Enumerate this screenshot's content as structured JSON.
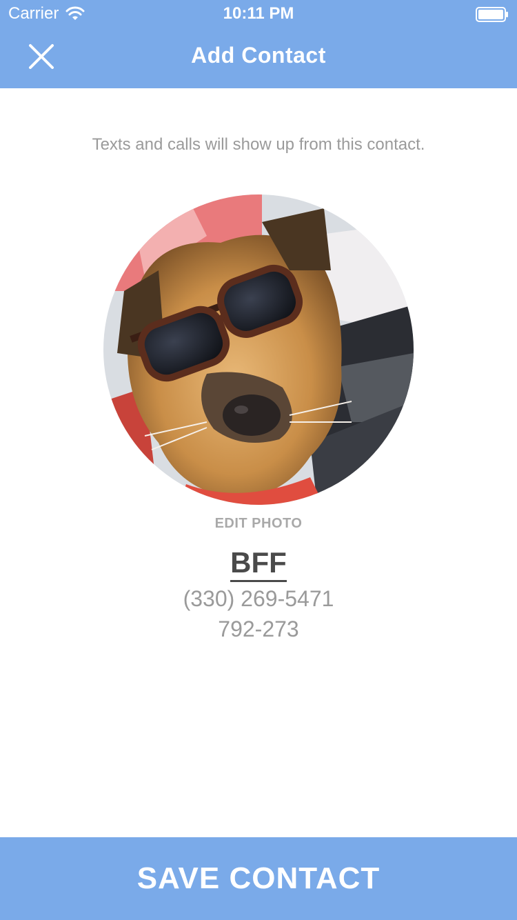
{
  "status_bar": {
    "carrier": "Carrier",
    "time": "10:11 PM",
    "wifi_icon": "wifi-icon",
    "battery_icon": "battery-icon"
  },
  "header": {
    "title": "Add Contact",
    "close_icon": "close-icon",
    "background_color": "#7aaae9"
  },
  "subtitle": "Texts and calls will show up from this contact.",
  "avatar": {
    "image": "dog-with-sunglasses"
  },
  "edit_photo_label": "EDIT PHOTO",
  "contact": {
    "name": "BFF",
    "phone": "(330) 269-5471",
    "extension": "792-273"
  },
  "save_button": {
    "label": "SAVE CONTACT",
    "background_color": "#7aaae9"
  }
}
